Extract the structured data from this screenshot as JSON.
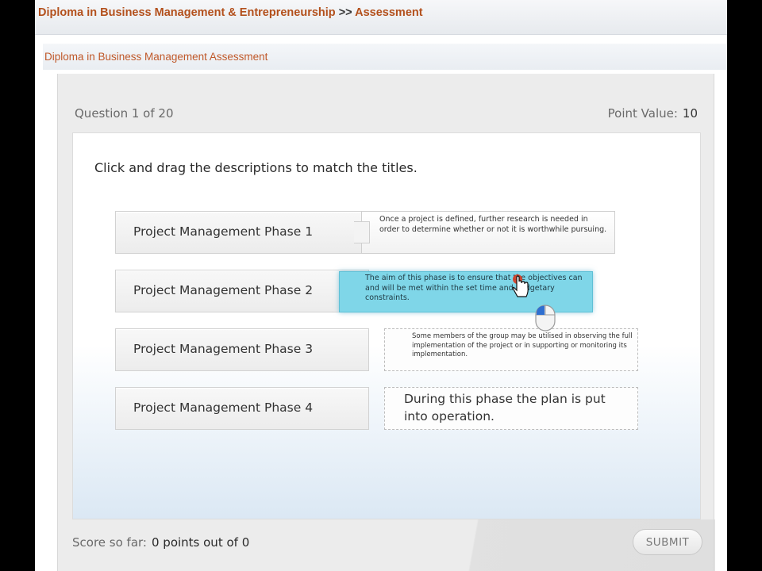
{
  "breadcrumb": {
    "course": "Diploma in Business Management & Entrepreneurship",
    "separator": ">>",
    "current": "Assessment"
  },
  "assessment_title": "Diploma in Business Management Assessment",
  "question": {
    "counter": "Question 1 of 20",
    "point_value_label": "Point Value:",
    "point_value": "10",
    "instructions": "Click and drag the descriptions to match the titles."
  },
  "titles": [
    "Project Management Phase 1",
    "Project Management Phase 2",
    "Project Management Phase 3",
    "Project Management Phase 4"
  ],
  "descriptions": [
    "Once a project is defined, further research is needed in order to determine whether or not it is worthwhile pursuing.",
    "The aim of this phase is to ensure that the objectives can and will be met within the set time and budgetary constraints.",
    "Some members of the group may be utilised in observing the full implementation of the project or in supporting or monitoring its implementation.",
    "During this phase the plan is put into operation."
  ],
  "score": {
    "label": "Score so far:",
    "value": "0 points out of 0"
  },
  "submit_label": "SUBMIT",
  "colors": {
    "accent_orange": "#b3501c",
    "drag_highlight": "#7fd6e8"
  }
}
